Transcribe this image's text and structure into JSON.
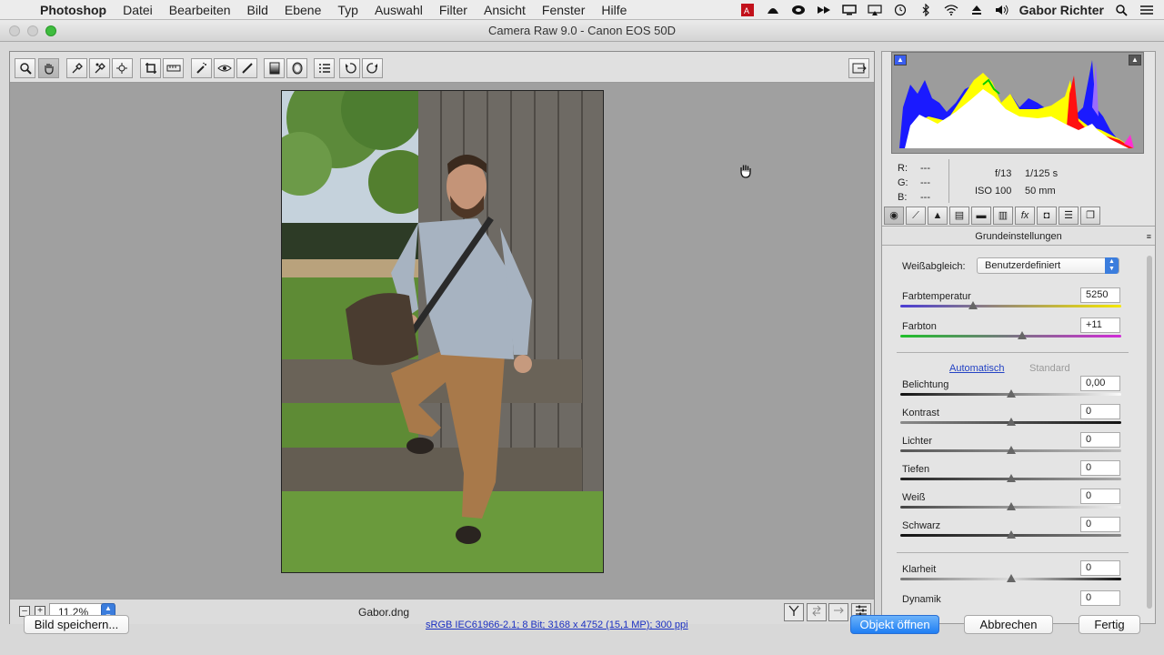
{
  "menubar": {
    "app_name": "Photoshop",
    "items": [
      "Datei",
      "Bearbeiten",
      "Bild",
      "Ebene",
      "Typ",
      "Auswahl",
      "Filter",
      "Ansicht",
      "Fenster",
      "Hilfe"
    ],
    "user": "Gabor Richter"
  },
  "window": {
    "title": "Camera Raw 9.0 - Canon EOS 50D"
  },
  "preview": {
    "zoom": "11,2%",
    "filename": "Gabor.dng"
  },
  "info": {
    "r_label": "R:",
    "g_label": "G:",
    "b_label": "B:",
    "r": "---",
    "g": "---",
    "b": "---",
    "aperture": "f/13",
    "shutter": "1/125 s",
    "iso": "ISO 100",
    "focal": "50 mm"
  },
  "panel": {
    "section_title": "Grundeinstellungen",
    "wb_label": "Weißabgleich:",
    "wb_value": "Benutzerdefiniert",
    "auto_label": "Automatisch",
    "default_label": "Standard",
    "sliders": [
      {
        "label": "Farbtemperatur",
        "value": "5250",
        "position": 0.33
      },
      {
        "label": "Farbton",
        "value": "+11",
        "position": 0.55
      },
      {
        "label": "Belichtung",
        "value": "0,00",
        "position": 0.5
      },
      {
        "label": "Kontrast",
        "value": "0",
        "position": 0.5
      },
      {
        "label": "Lichter",
        "value": "0",
        "position": 0.5
      },
      {
        "label": "Tiefen",
        "value": "0",
        "position": 0.5
      },
      {
        "label": "Weiß",
        "value": "0",
        "position": 0.5
      },
      {
        "label": "Schwarz",
        "value": "0",
        "position": 0.5
      },
      {
        "label": "Klarheit",
        "value": "0",
        "position": 0.5
      },
      {
        "label": "Dynamik",
        "value": "0",
        "position": 0.5
      }
    ]
  },
  "bottom": {
    "save_label": "Bild speichern...",
    "workflow": "sRGB IEC61966-2.1; 8 Bit; 3168 x 4752 (15,1 MP); 300 ppi",
    "open_label": "Objekt öffnen",
    "cancel_label": "Abbrechen",
    "done_label": "Fertig"
  },
  "colors": {
    "accent": "#1f7ef3",
    "link": "#2443c4"
  }
}
